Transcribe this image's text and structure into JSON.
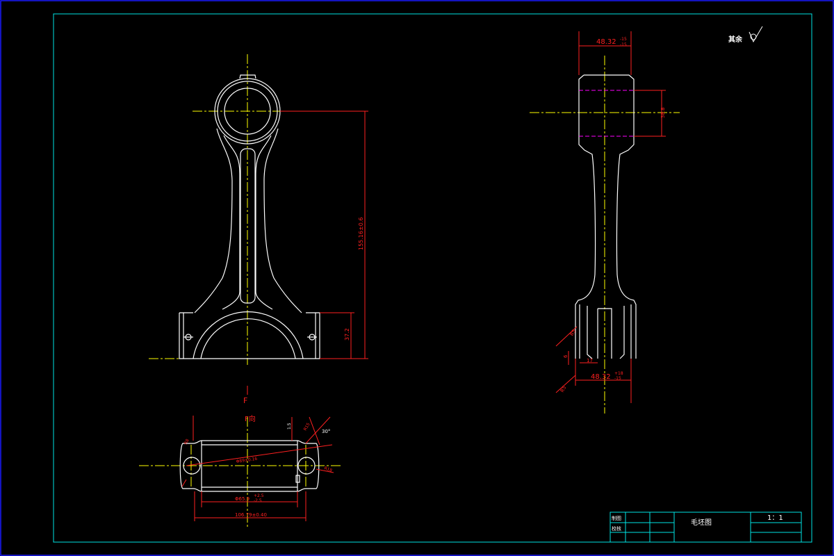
{
  "colors": {
    "background": "#000000",
    "outer_border": "#1a1aff",
    "frame": "#00e5e5",
    "part_outline": "#ffffff",
    "center_line": "#ffff00",
    "dimension": "#ff2020",
    "hidden_line": "#ff00ff"
  },
  "surface_note": {
    "text": "其余",
    "icon": "roughness-symbol-icon"
  },
  "front_view": {
    "dim_total_height": "155.16±0.6",
    "dim_cap_height": "37.2"
  },
  "side_view": {
    "dim_top_width": {
      "base": "48.32",
      "upper": "-15",
      "lower": "-15"
    },
    "dim_top_height": "38.8",
    "dim_bottom_width": {
      "base": "48.32",
      "upper": "+18",
      "lower": "-15"
    },
    "dim_bottom_offset": "17",
    "dim_small_1": "6",
    "dim_small_2": "R5",
    "dim_small_3": "R5"
  },
  "section_view": {
    "label_f": "F",
    "label_f_dir": "F向",
    "dim_bore": {
      "base": "Φ65.9",
      "upper": "+2.5",
      "lower": "-2.5"
    },
    "dim_overall": "106.79±0.40",
    "dim_diag": "Φ89±0.16",
    "dim_angle": "30°",
    "dim_r1": "R15",
    "dim_r2": "R8",
    "dim_r3": "R18",
    "dim_small": "1.5"
  },
  "title_block": {
    "row1_label": "制图",
    "row2_label": "校核",
    "drawing_name": "毛坯图",
    "scale": "1：1"
  }
}
